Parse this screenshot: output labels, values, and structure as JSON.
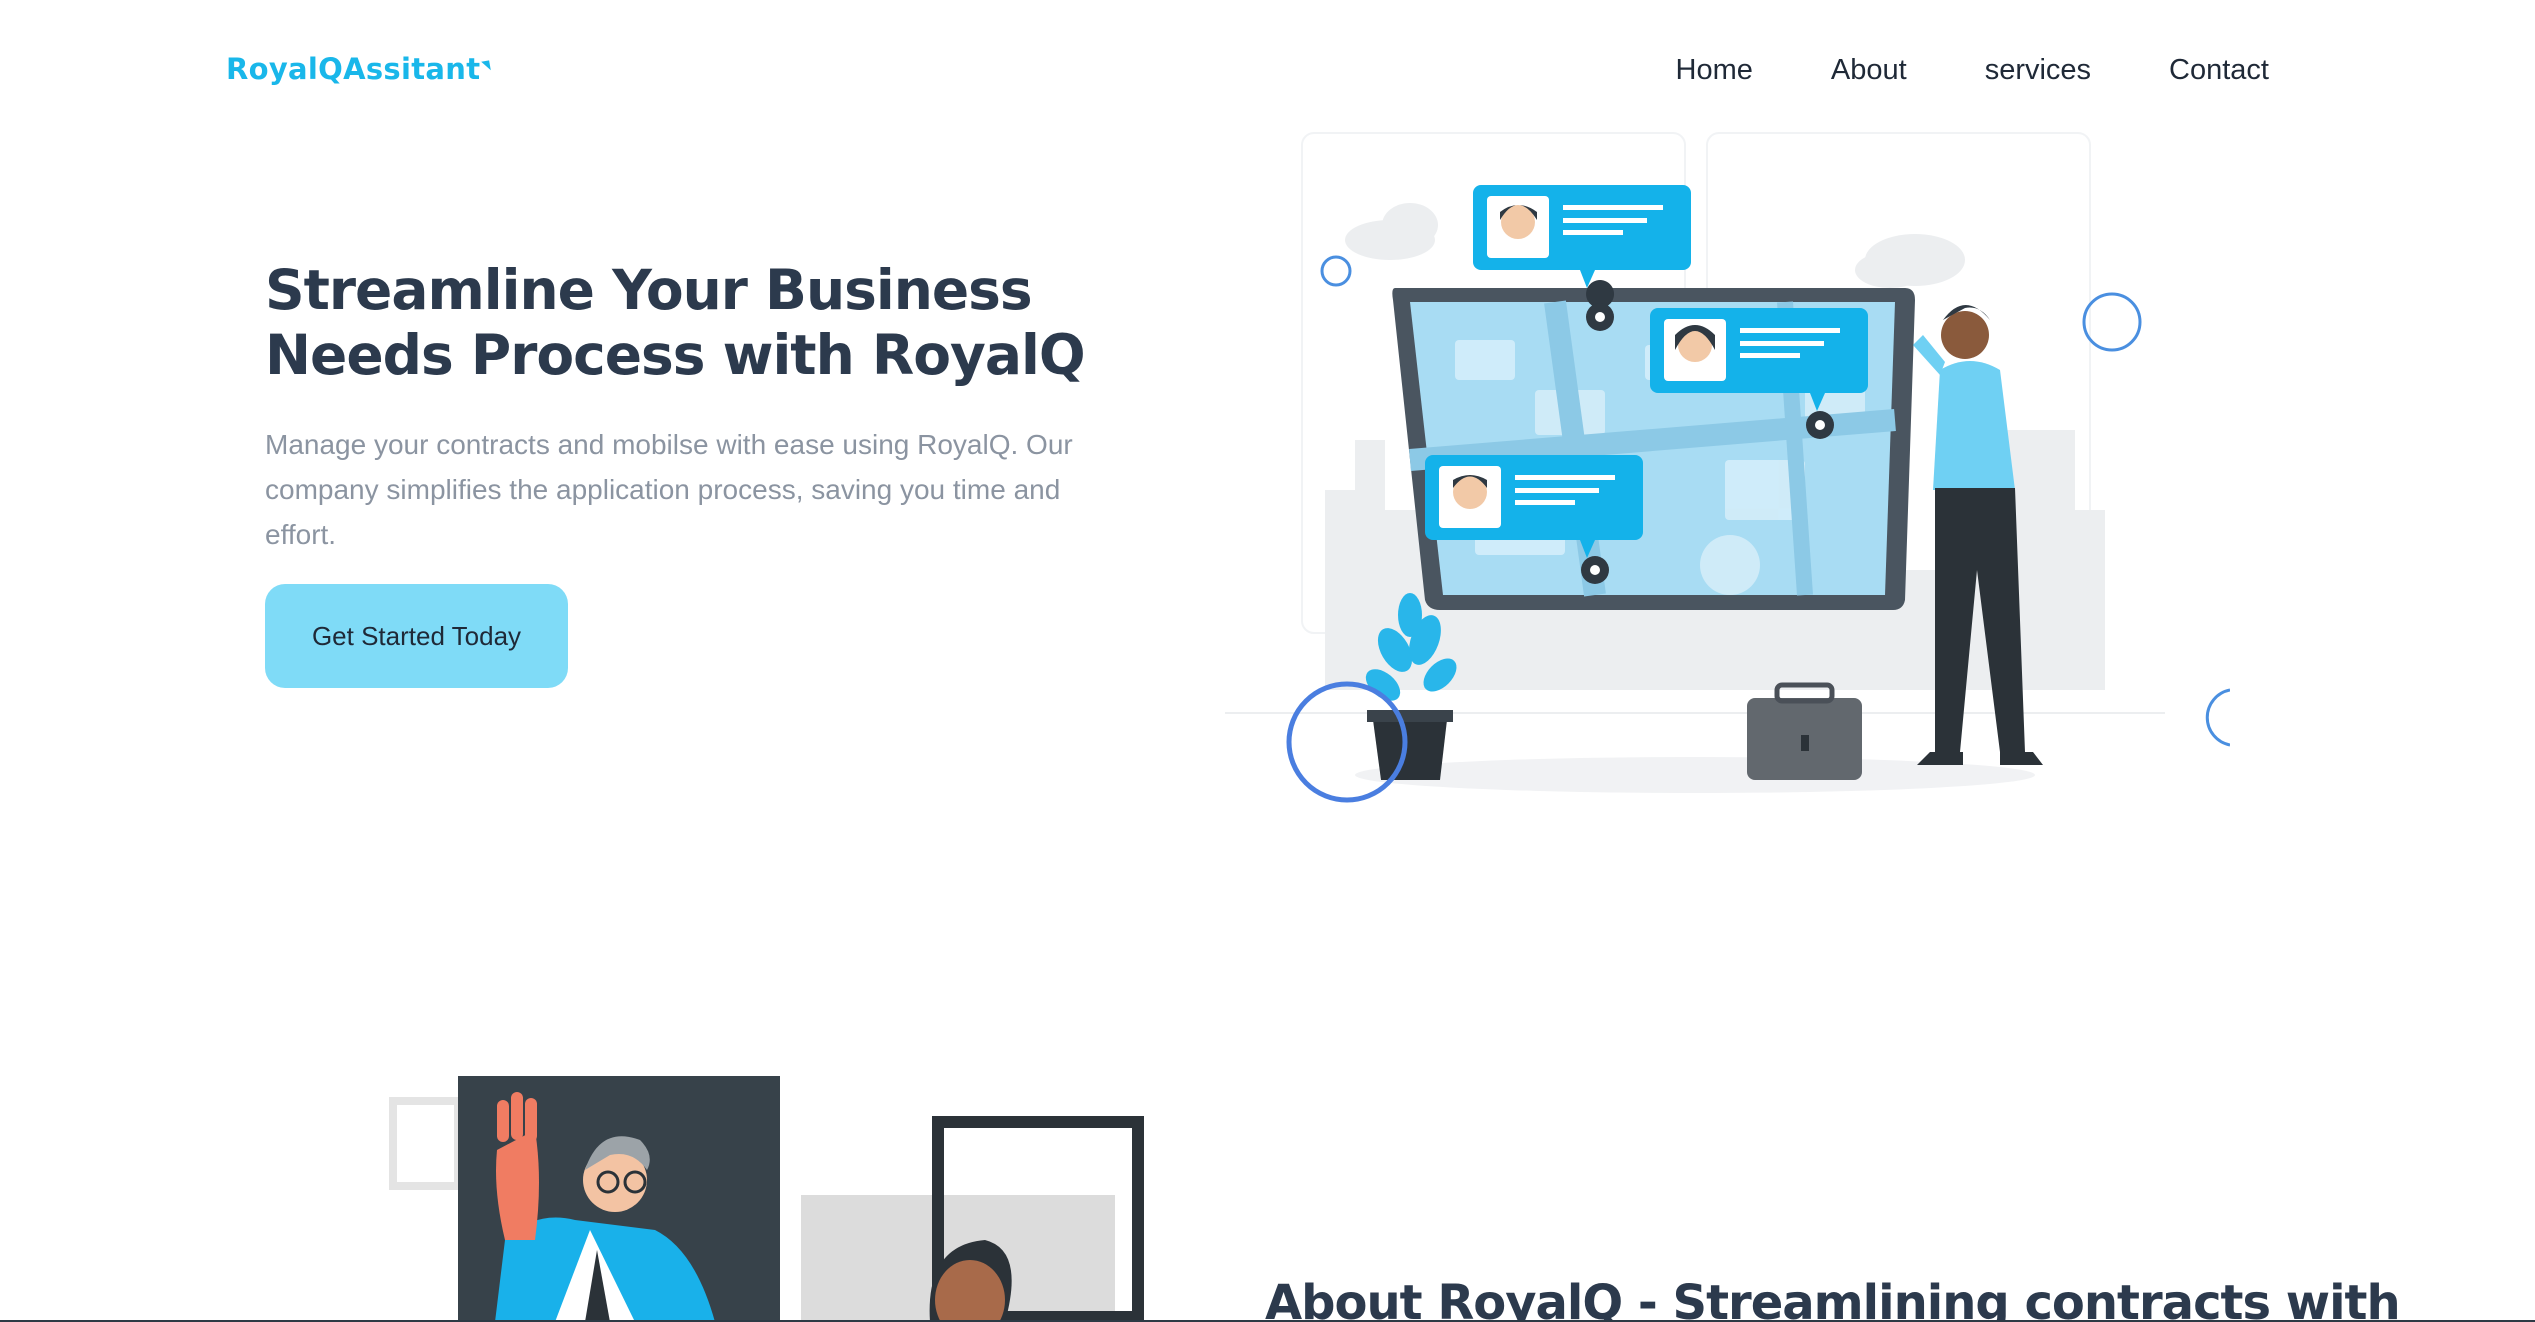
{
  "nav": {
    "brand": "RoyalQAssitant",
    "links": [
      "Home",
      "About",
      "services",
      "Contact"
    ]
  },
  "hero": {
    "title": "Streamline Your Business Needs Process with RoyalQ",
    "description": "Manage your contracts and mobilse with ease using RoyalQ. Our company simplifies the application process, saving you time and effort.",
    "cta_label": "Get Started Today"
  },
  "about": {
    "title": "About RoyalQ - Streamlining contracts with"
  },
  "colors": {
    "brand": "#19b7ea",
    "cta_bg": "#7fdbf7",
    "heading": "#2c3a4d",
    "body_text": "#8b94a1",
    "accent_ring": "#4a8fe0"
  },
  "icons": [
    "hero-map-illustration-icon",
    "about-people-illustration-icon"
  ]
}
